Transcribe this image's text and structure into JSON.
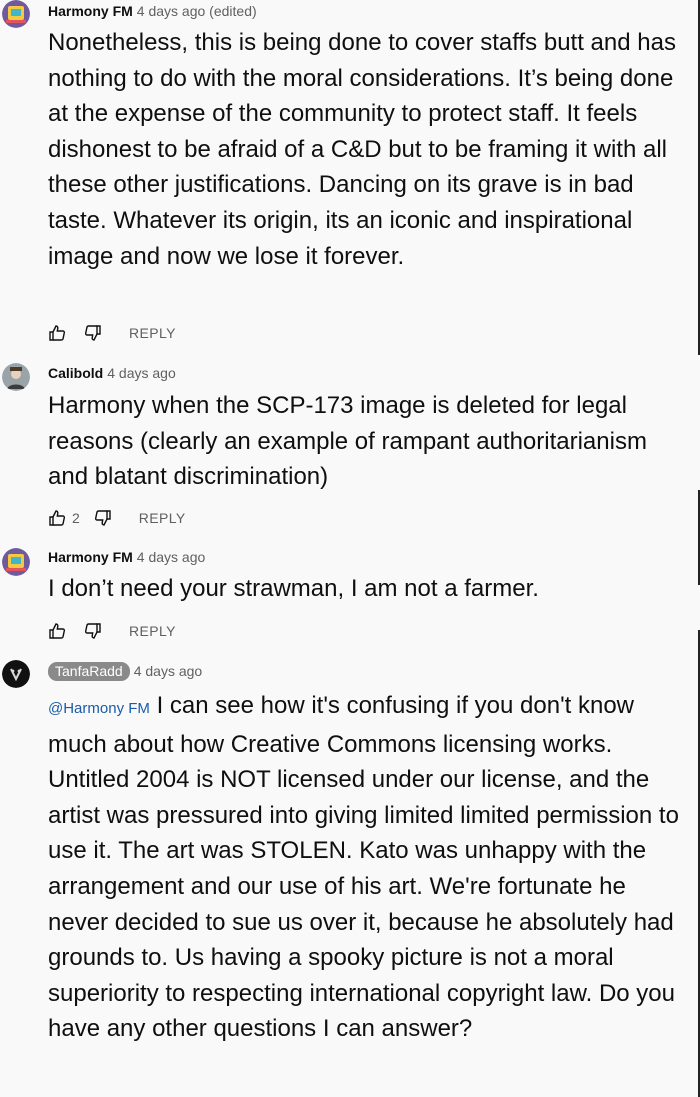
{
  "comments": [
    {
      "author": "Harmony FM",
      "time": "4 days ago (edited)",
      "text": "Nonetheless, this is being done to cover staffs butt and has nothing to do with the moral considerations. It’s being done at the expense of the community to protect staff. It feels dishonest to be afraid of a C&D but to be framing it with all these other justifications. Dancing on its grave is in bad taste. Whatever its origin, its an iconic and inspirational image and now we lose it forever.",
      "likes": "",
      "reply_label": "REPLY"
    },
    {
      "author": "Calibold",
      "time": "4 days ago",
      "text": "Harmony when the SCP-173 image is deleted for legal reasons (clearly an example of rampant authoritarianism and blatant discrimination)",
      "likes": "2",
      "reply_label": "REPLY"
    },
    {
      "author": "Harmony FM",
      "time": "4 days ago",
      "text": "I don’t need your strawman, I am not a farmer.",
      "likes": "",
      "reply_label": "REPLY"
    },
    {
      "author": "TanfaRadd",
      "time": "4 days ago",
      "mention": "@Harmony FM",
      "text": "I can see how it's confusing if you don't know much about how Creative Commons licensing works. Untitled 2004 is NOT licensed under our license, and the artist was pressured into giving limited limited permission to use it. The art was STOLEN. Kato was unhappy with the arrangement and our use of his art. We're fortunate he never decided to sue us over it, because he absolutely had grounds to. Us having a spooky picture is not a moral superiority to respecting international copyright law. Do you have any other questions I can answer?",
      "likes": "",
      "reply_label": "REPLY"
    }
  ],
  "icons": {
    "like": "thumbs-up-icon",
    "dislike": "thumbs-down-icon"
  },
  "colors": {
    "background": "#f9f9f9",
    "text": "#0f0f0f",
    "meta": "#606060",
    "mention": "#1a5ca8",
    "chip": "#8a8a8a"
  }
}
